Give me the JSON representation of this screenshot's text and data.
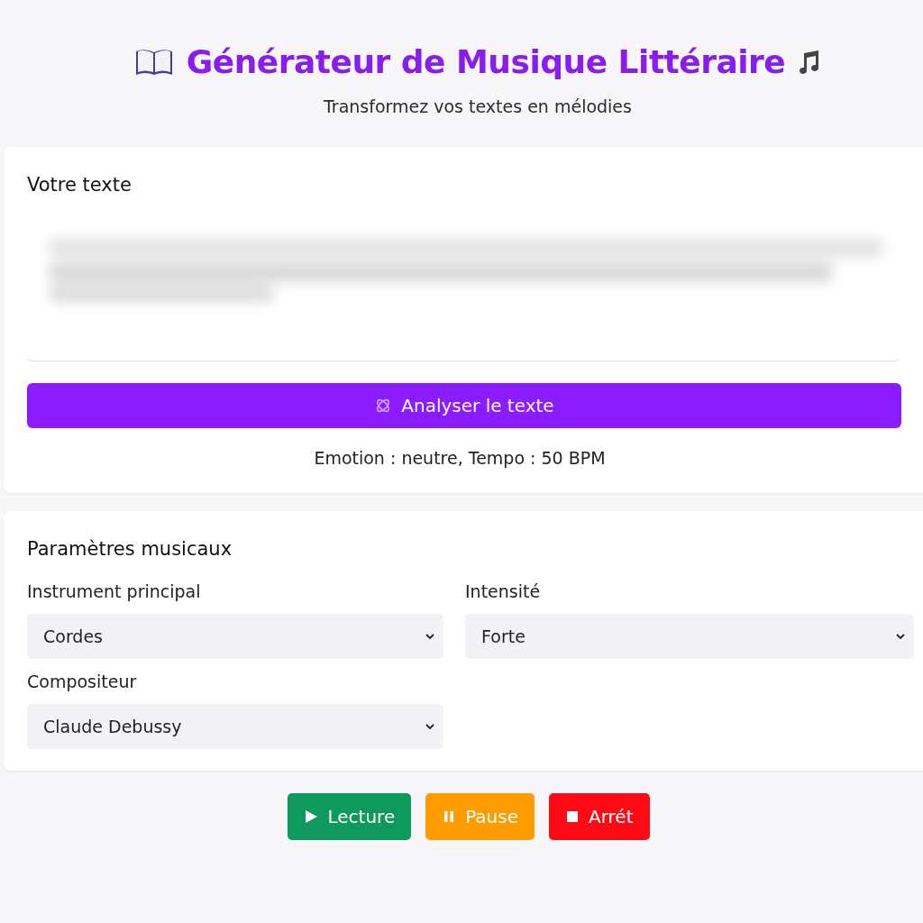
{
  "header": {
    "title": "Générateur de Musique Littéraire",
    "subtitle": "Transformez vos textes en mélodies"
  },
  "text_section": {
    "heading": "Votre texte",
    "analyze_button": "Analyser le texte",
    "result": "Emotion : neutre, Tempo : 50 BPM"
  },
  "settings": {
    "heading": "Paramètres musicaux",
    "fields": [
      {
        "label": "Instrument principal",
        "value": "Cordes"
      },
      {
        "label": "Intensité",
        "value": "Forte"
      },
      {
        "label": "Compositeur",
        "value": "Claude Debussy"
      }
    ]
  },
  "controls": [
    {
      "kind": "play",
      "label": "Lecture"
    },
    {
      "kind": "pause",
      "label": "Pause"
    },
    {
      "kind": "stop",
      "label": "Arrét"
    }
  ]
}
